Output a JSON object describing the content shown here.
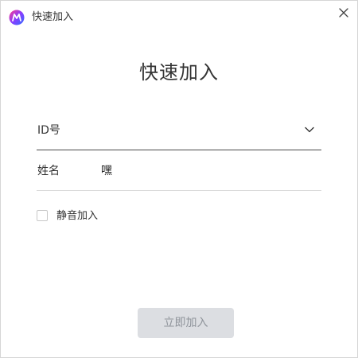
{
  "window": {
    "title": "快速加入"
  },
  "main": {
    "heading": "快速加入"
  },
  "form": {
    "id_field": {
      "label": "ID号",
      "value": ""
    },
    "name_field": {
      "label": "姓名",
      "value": "嘿"
    },
    "mute_checkbox": {
      "label": "静音加入",
      "checked": false
    },
    "join_button": {
      "label": "立即加入",
      "enabled": false
    }
  },
  "icons": {
    "logo": "app-logo-icon",
    "close": "close-icon",
    "dropdown": "chevron-down-icon"
  },
  "colors": {
    "text": "#333333",
    "button_disabled_bg": "#dcdee2",
    "button_disabled_text": "#8f949b",
    "active_underline": "#4a4a4a",
    "inactive_underline": "#d9d9d9"
  }
}
